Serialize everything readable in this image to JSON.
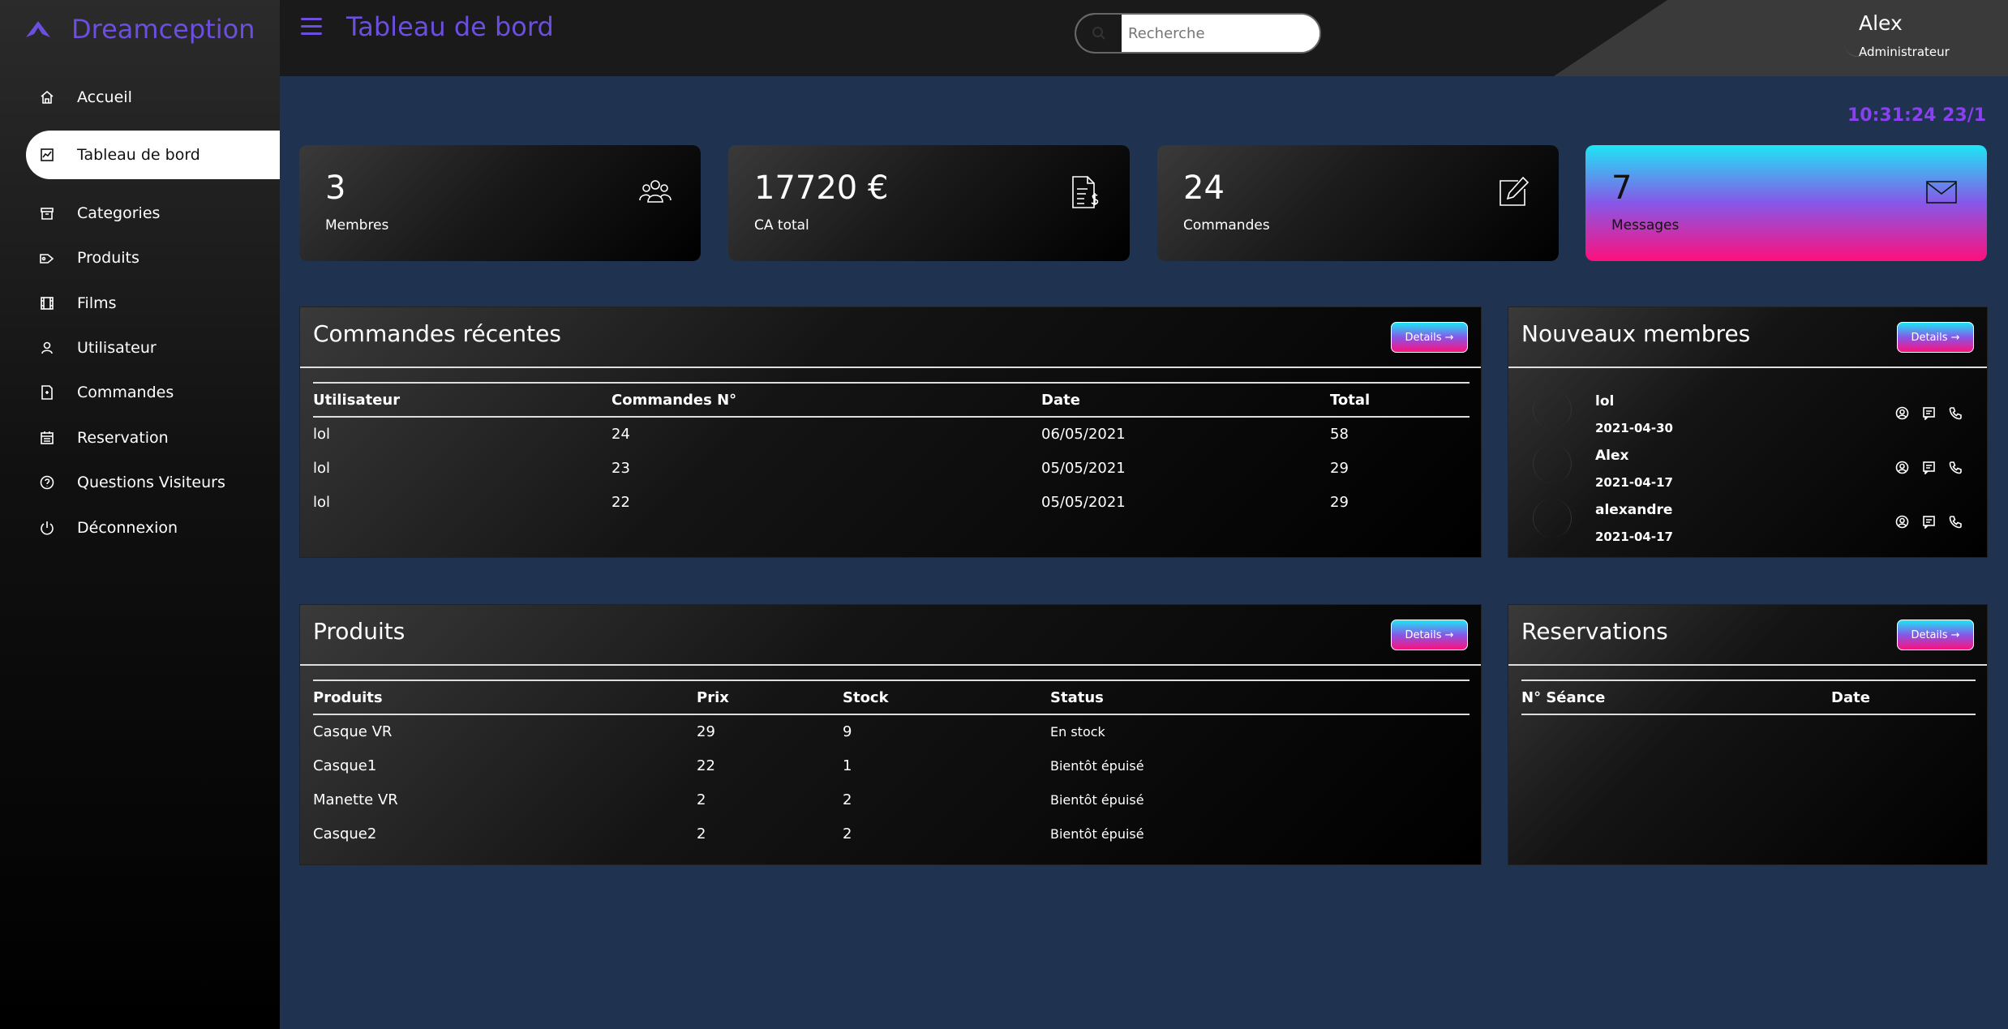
{
  "app": {
    "name": "Dreamception"
  },
  "sidebar": {
    "items": [
      {
        "label": "Accueil",
        "icon": "home-icon"
      },
      {
        "label": "Tableau de bord",
        "icon": "chart-icon",
        "active": true
      },
      {
        "label": "Categories",
        "icon": "archive-icon"
      },
      {
        "label": "Produits",
        "icon": "tag-icon"
      },
      {
        "label": "Films",
        "icon": "film-icon"
      },
      {
        "label": "Utilisateur",
        "icon": "user-icon"
      },
      {
        "label": "Commandes",
        "icon": "order-icon"
      },
      {
        "label": "Reservation",
        "icon": "calendar-icon"
      },
      {
        "label": "Questions Visiteurs",
        "icon": "question-icon"
      },
      {
        "label": "Déconnexion",
        "icon": "power-icon"
      }
    ]
  },
  "header": {
    "title": "Tableau de bord",
    "search_placeholder": "Recherche",
    "user": {
      "name": "Alex",
      "role": "Administrateur"
    }
  },
  "clock": "10:31:24 23/1",
  "stats": [
    {
      "value": "3",
      "label": "Membres",
      "icon": "users-icon"
    },
    {
      "value": "17720 €",
      "label": "CA total",
      "icon": "invoice-icon"
    },
    {
      "value": "24",
      "label": "Commandes",
      "icon": "edit-icon"
    },
    {
      "value": "7",
      "label": "Messages",
      "icon": "mail-icon"
    }
  ],
  "details_label": "Details →",
  "recent_orders": {
    "title": "Commandes récentes",
    "columns": [
      "Utilisateur",
      "Commandes N°",
      "Date",
      "Total"
    ],
    "rows": [
      [
        "lol",
        "24",
        "06/05/2021",
        "58"
      ],
      [
        "lol",
        "23",
        "05/05/2021",
        "29"
      ],
      [
        "lol",
        "22",
        "05/05/2021",
        "29"
      ]
    ]
  },
  "new_members": {
    "title": "Nouveaux membres",
    "members": [
      {
        "name": "lol",
        "date": "2021-04-30"
      },
      {
        "name": "Alex",
        "date": "2021-04-17"
      },
      {
        "name": "alexandre",
        "date": "2021-04-17"
      }
    ]
  },
  "products": {
    "title": "Produits",
    "columns": [
      "Produits",
      "Prix",
      "Stock",
      "Status"
    ],
    "rows": [
      [
        "Casque VR",
        "29",
        "9",
        "En stock"
      ],
      [
        "Casque1",
        "22",
        "1",
        "Bientôt épuisé"
      ],
      [
        "Manette VR",
        "2",
        "2",
        "Bientôt épuisé"
      ],
      [
        "Casque2",
        "2",
        "2",
        "Bientôt épuisé"
      ]
    ]
  },
  "reservations": {
    "title": "Reservations",
    "columns": [
      "N° Séance",
      "Date"
    ],
    "rows": []
  },
  "colors": {
    "accent": "#6c4ee0",
    "clock": "#8a3ff0",
    "gradient_top": "#1ee6f5",
    "gradient_mid": "#8757e8",
    "gradient_bottom": "#ff0f7b",
    "page_bg": "#1f3350"
  }
}
